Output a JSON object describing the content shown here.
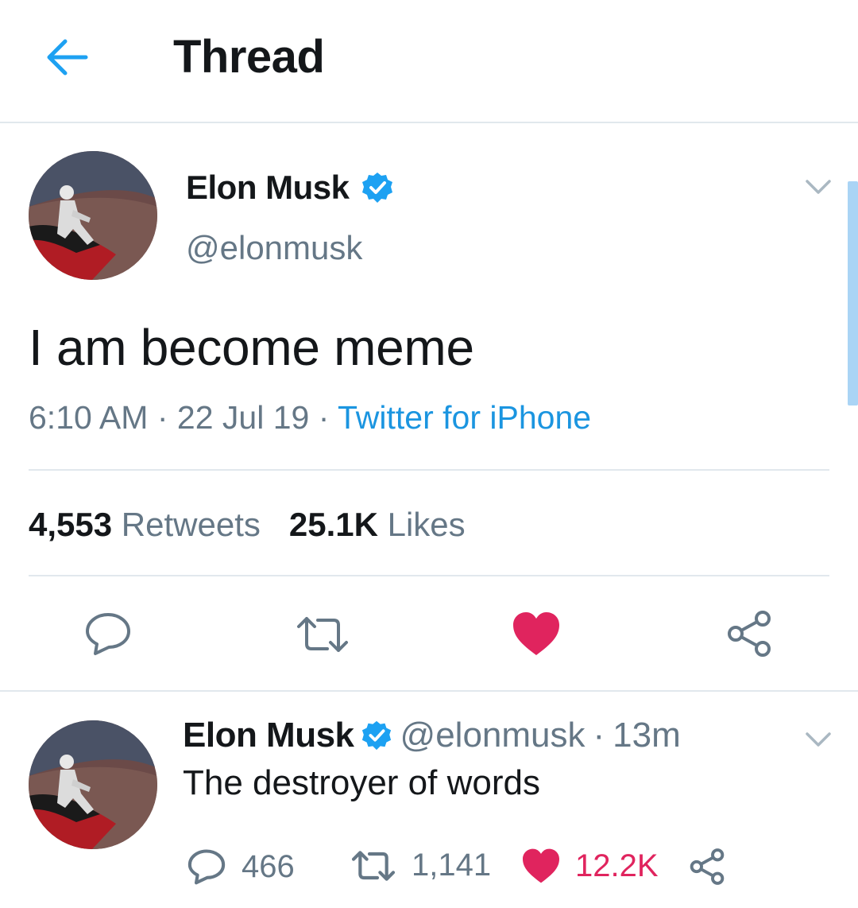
{
  "header": {
    "title": "Thread"
  },
  "main_tweet": {
    "author_name": "Elon Musk",
    "handle": "@elonmusk",
    "text": "I am become meme",
    "time": "6:10 AM",
    "date": "22 Jul 19",
    "source": "Twitter for iPhone",
    "retweet_count": "4,553",
    "retweet_label": "Retweets",
    "like_count": "25.1K",
    "like_label": "Likes"
  },
  "reply_tweet": {
    "author_name": "Elon Musk",
    "handle": "@elonmusk",
    "age": "13m",
    "text": "The destroyer of words",
    "reply_count": "466",
    "retweet_count": "1,141",
    "like_count": "12.2K"
  },
  "colors": {
    "accent": "#1da1f2",
    "link": "#1b95e0",
    "like": "#e0245e",
    "muted": "#657786",
    "divider": "#e1e8ed"
  },
  "icons": [
    "back-arrow-icon",
    "verified-badge-icon",
    "chevron-down-icon",
    "reply-icon",
    "retweet-icon",
    "heart-icon",
    "share-icon"
  ]
}
